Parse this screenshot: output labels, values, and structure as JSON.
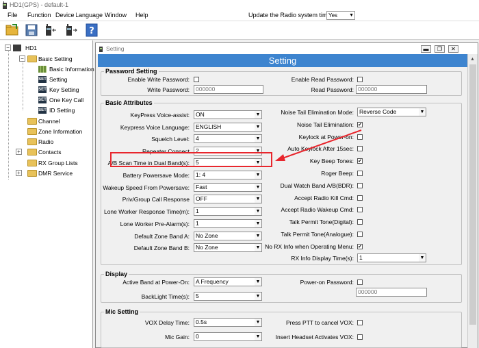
{
  "app": {
    "title": "HD1(GPS)  -  default-1"
  },
  "menu": {
    "items": [
      "File",
      "Function",
      "Device",
      "Language",
      "Window",
      "Help"
    ],
    "update_label": "Update the Radio system time",
    "update_value": "Yes"
  },
  "toolbar": {
    "icons": [
      "open-folder-icon",
      "save-icon",
      "read-radio-icon",
      "write-radio-icon",
      "help-icon"
    ]
  },
  "tree": {
    "root": "HD1",
    "items": [
      {
        "label": "Basic Setting"
      },
      {
        "label": "Basic Information"
      },
      {
        "label": "Setting"
      },
      {
        "label": "Key Setting"
      },
      {
        "label": "One Key Call"
      },
      {
        "label": "ID Setting"
      },
      {
        "label": "Channel"
      },
      {
        "label": "Zone Information"
      },
      {
        "label": "Radio"
      },
      {
        "label": "Contacts"
      },
      {
        "label": "RX Group Lists"
      },
      {
        "label": "DMR Service"
      }
    ]
  },
  "window": {
    "title": "Setting",
    "banner": "Setting"
  },
  "password": {
    "title": "Password Setting",
    "enable_write_label": "Enable Write Password:",
    "write_label": "Write Password:",
    "write_value": "000000",
    "enable_read_label": "Enable Read Password:",
    "read_label": "Read Password:",
    "read_value": "000000"
  },
  "basic": {
    "title": "Basic Attributes",
    "left": [
      {
        "label": "KeyPress Voice-assist:",
        "value": "ON"
      },
      {
        "label": "Keypress Voice Language:",
        "value": "ENGLISH"
      },
      {
        "label": "Squelch Level:",
        "value": "4"
      },
      {
        "label": "Repeater Connect",
        "value": "2"
      },
      {
        "label": "A/B Scan Time in Dual Band(s):",
        "value": "5"
      },
      {
        "label": "Battery Powersave Mode:",
        "value": "1:  4"
      },
      {
        "label": "Wakeup Speed From Powersave:",
        "value": "Fast"
      },
      {
        "label": "Priv/Group Call Response",
        "value": "OFF"
      },
      {
        "label": "Lone Worker Response Time(m):",
        "value": "1"
      },
      {
        "label": "Lone Worker Pre-Alarm(s):",
        "value": "1"
      },
      {
        "label": "Default Zone Band A:",
        "value": "No Zone"
      },
      {
        "label": "Default Zone Band B:",
        "value": "No Zone"
      }
    ],
    "right": [
      {
        "label": "Noise Tail Elimination Mode:",
        "type": "select",
        "value": "Reverse Code"
      },
      {
        "label": "Noise Tail Elimination:",
        "type": "check",
        "checked": "✔"
      },
      {
        "label": "Keylock at Power-on:",
        "type": "check",
        "checked": ""
      },
      {
        "label": "Auto Keylock After 15sec:",
        "type": "check",
        "checked": ""
      },
      {
        "label": "Key Beep Tones:",
        "type": "check",
        "checked": "✔"
      },
      {
        "label": "Roger Beep:",
        "type": "check",
        "checked": ""
      },
      {
        "label": "Dual Watch Band A/B(BDR):",
        "type": "check",
        "checked": ""
      },
      {
        "label": "Accept Radio Kill Cmd:",
        "type": "check",
        "checked": ""
      },
      {
        "label": "Accept Radio Wakeup Cmd:",
        "type": "check",
        "checked": ""
      },
      {
        "label": "Talk Permit Tone(Digital):",
        "type": "check",
        "checked": ""
      },
      {
        "label": "Talk Permit Tone(Analogue):",
        "type": "check",
        "checked": ""
      },
      {
        "label": "No RX Info when Operating Menu:",
        "type": "check",
        "checked": "✔"
      },
      {
        "label": "RX Info Display Time(s):",
        "type": "select",
        "value": "1"
      }
    ]
  },
  "display": {
    "title": "Display",
    "active_band_label": "Active Band at Power-On:",
    "active_band_value": "A Frequency",
    "backlight_label": "BackLight Time(s):",
    "backlight_value": "5",
    "power_on_pw_label": "Power-on Password:",
    "power_on_pw_value": "000000"
  },
  "mic": {
    "title": "Mic Setting",
    "vox_delay_label": "VOX Delay Time:",
    "vox_delay_value": "0.5s",
    "mic_gain_label": "Mic Gain:",
    "mic_gain_value": "0",
    "ptt_cancel_label": "Press PTT to cancel VOX:",
    "headset_vox_label": "Insert Headset Activates VOX:"
  },
  "colors": {
    "banner": "#3d84cf",
    "highlight": "#e8262d"
  }
}
